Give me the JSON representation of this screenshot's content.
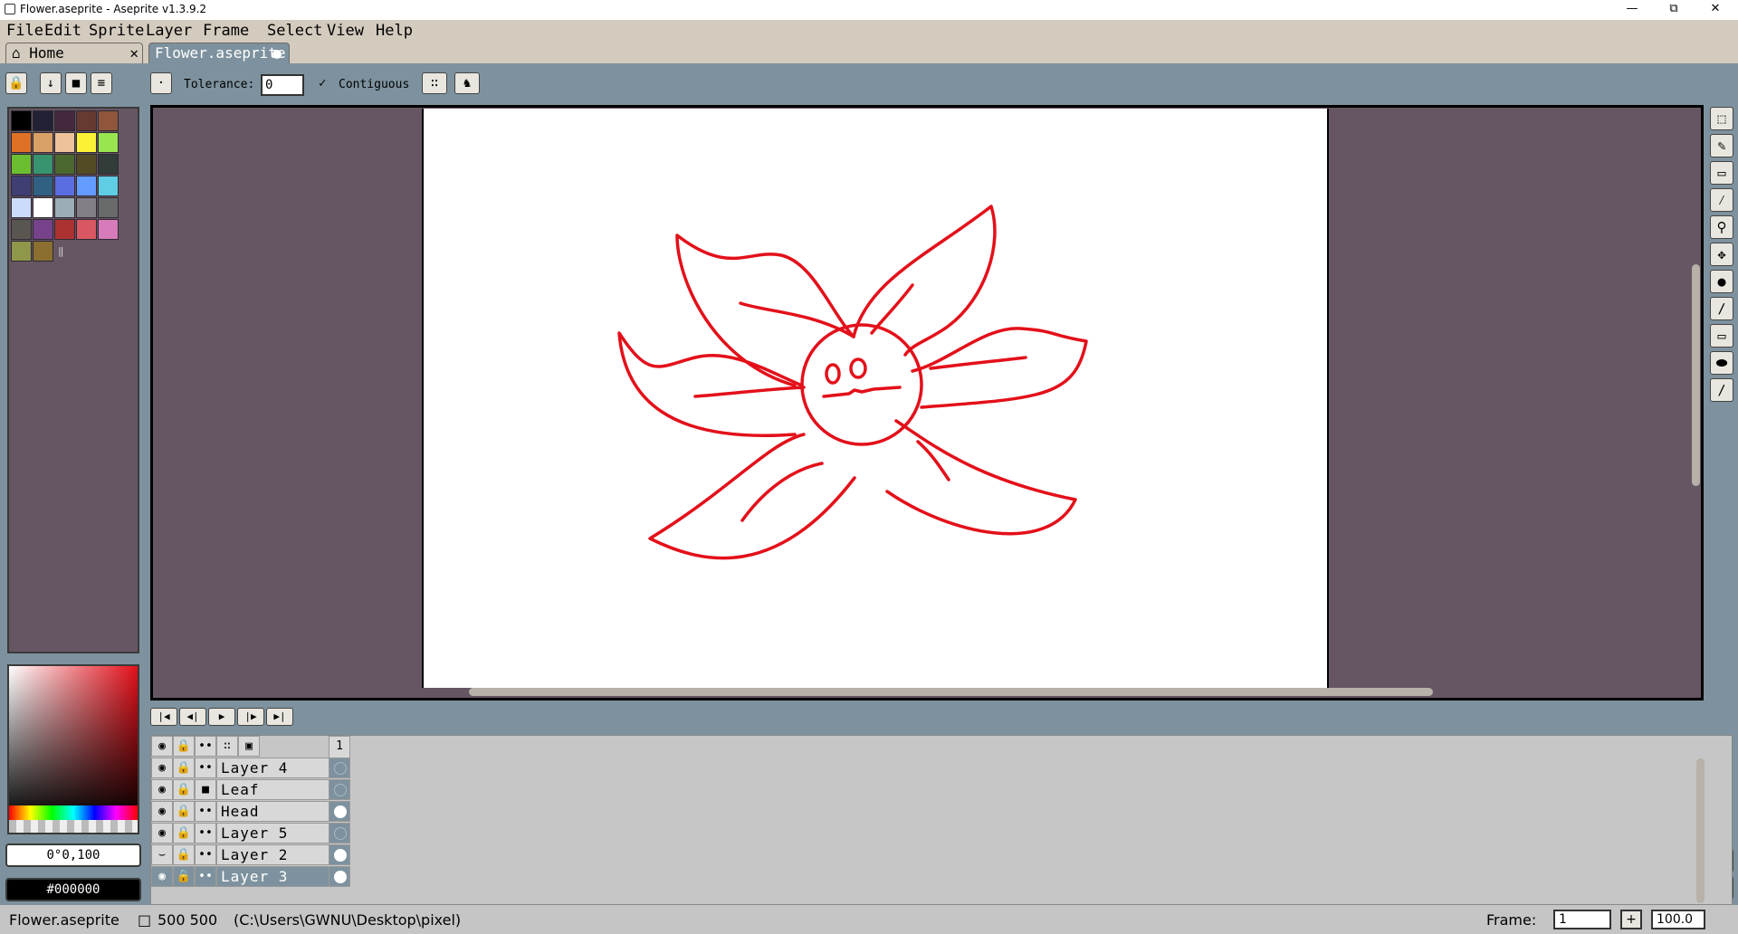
{
  "window": {
    "title": "Flower.aseprite - Aseprite v1.3.9.2",
    "minimize": "—",
    "maximize": "⧉",
    "close": "✕"
  },
  "menu": [
    "File",
    "Edit",
    "Sprite",
    "Layer",
    "Frame",
    "Select",
    "View",
    "Help"
  ],
  "tabs": {
    "home": "Home",
    "home_close": "✕",
    "file": "Flower.aseprite"
  },
  "context_bar": {
    "tolerance_label": "Tolerance:",
    "tolerance_value": "0",
    "contiguous_label": "Contiguous",
    "contiguous_checked": true
  },
  "palette": {
    "colors": [
      "#000000",
      "#222034",
      "#45283c",
      "#663931",
      "#8f563b",
      "#df7126",
      "#d9a066",
      "#eec39a",
      "#fbf236",
      "#99e550",
      "#6abe30",
      "#37946e",
      "#4b692f",
      "#524b24",
      "#323c39",
      "#3f3f74",
      "#306082",
      "#5b6ee1",
      "#639bff",
      "#5fcde4",
      "#cbdbfc",
      "#ffffff",
      "#9badb7",
      "#847e87",
      "#696a6a",
      "#595652",
      "#76428a",
      "#ac3232",
      "#d95763",
      "#d77bba",
      "#8f974a",
      "#8a6f30"
    ]
  },
  "color": {
    "hsv": "0°0,100",
    "hex": "#000000"
  },
  "tools": [
    "rectangular-marquee-icon",
    "pencil-icon",
    "eraser-icon",
    "eyedropper-icon",
    "zoom-icon",
    "move-icon",
    "paint-bucket-icon",
    "line-icon",
    "rectangle-icon",
    "contour-icon",
    "blur-icon"
  ],
  "timeline": {
    "frame_number": "1",
    "layers": [
      {
        "name": "Layer 4",
        "visible": true,
        "type": "layer",
        "selected": false,
        "cel_filled": false
      },
      {
        "name": "Leaf",
        "visible": true,
        "type": "group",
        "selected": false,
        "cel_filled": false
      },
      {
        "name": "Head",
        "visible": true,
        "type": "layer",
        "selected": false,
        "cel_filled": true
      },
      {
        "name": "Layer 5",
        "visible": true,
        "type": "layer",
        "selected": false,
        "cel_filled": false
      },
      {
        "name": "Layer 2",
        "visible": false,
        "type": "layer",
        "selected": false,
        "cel_filled": true
      },
      {
        "name": "Layer 3",
        "visible": true,
        "type": "layer",
        "selected": true,
        "cel_filled": true
      }
    ]
  },
  "status": {
    "filename": "Flower.aseprite",
    "size": "500 500",
    "path": "(C:\\Users\\GWNU\\Desktop\\pixel)",
    "frame_label": "Frame:",
    "frame_value": "1",
    "zoom": "100.0"
  },
  "colors": {
    "background": "#7d929e",
    "workspace": "#665663",
    "stroke": "#e3101a"
  }
}
